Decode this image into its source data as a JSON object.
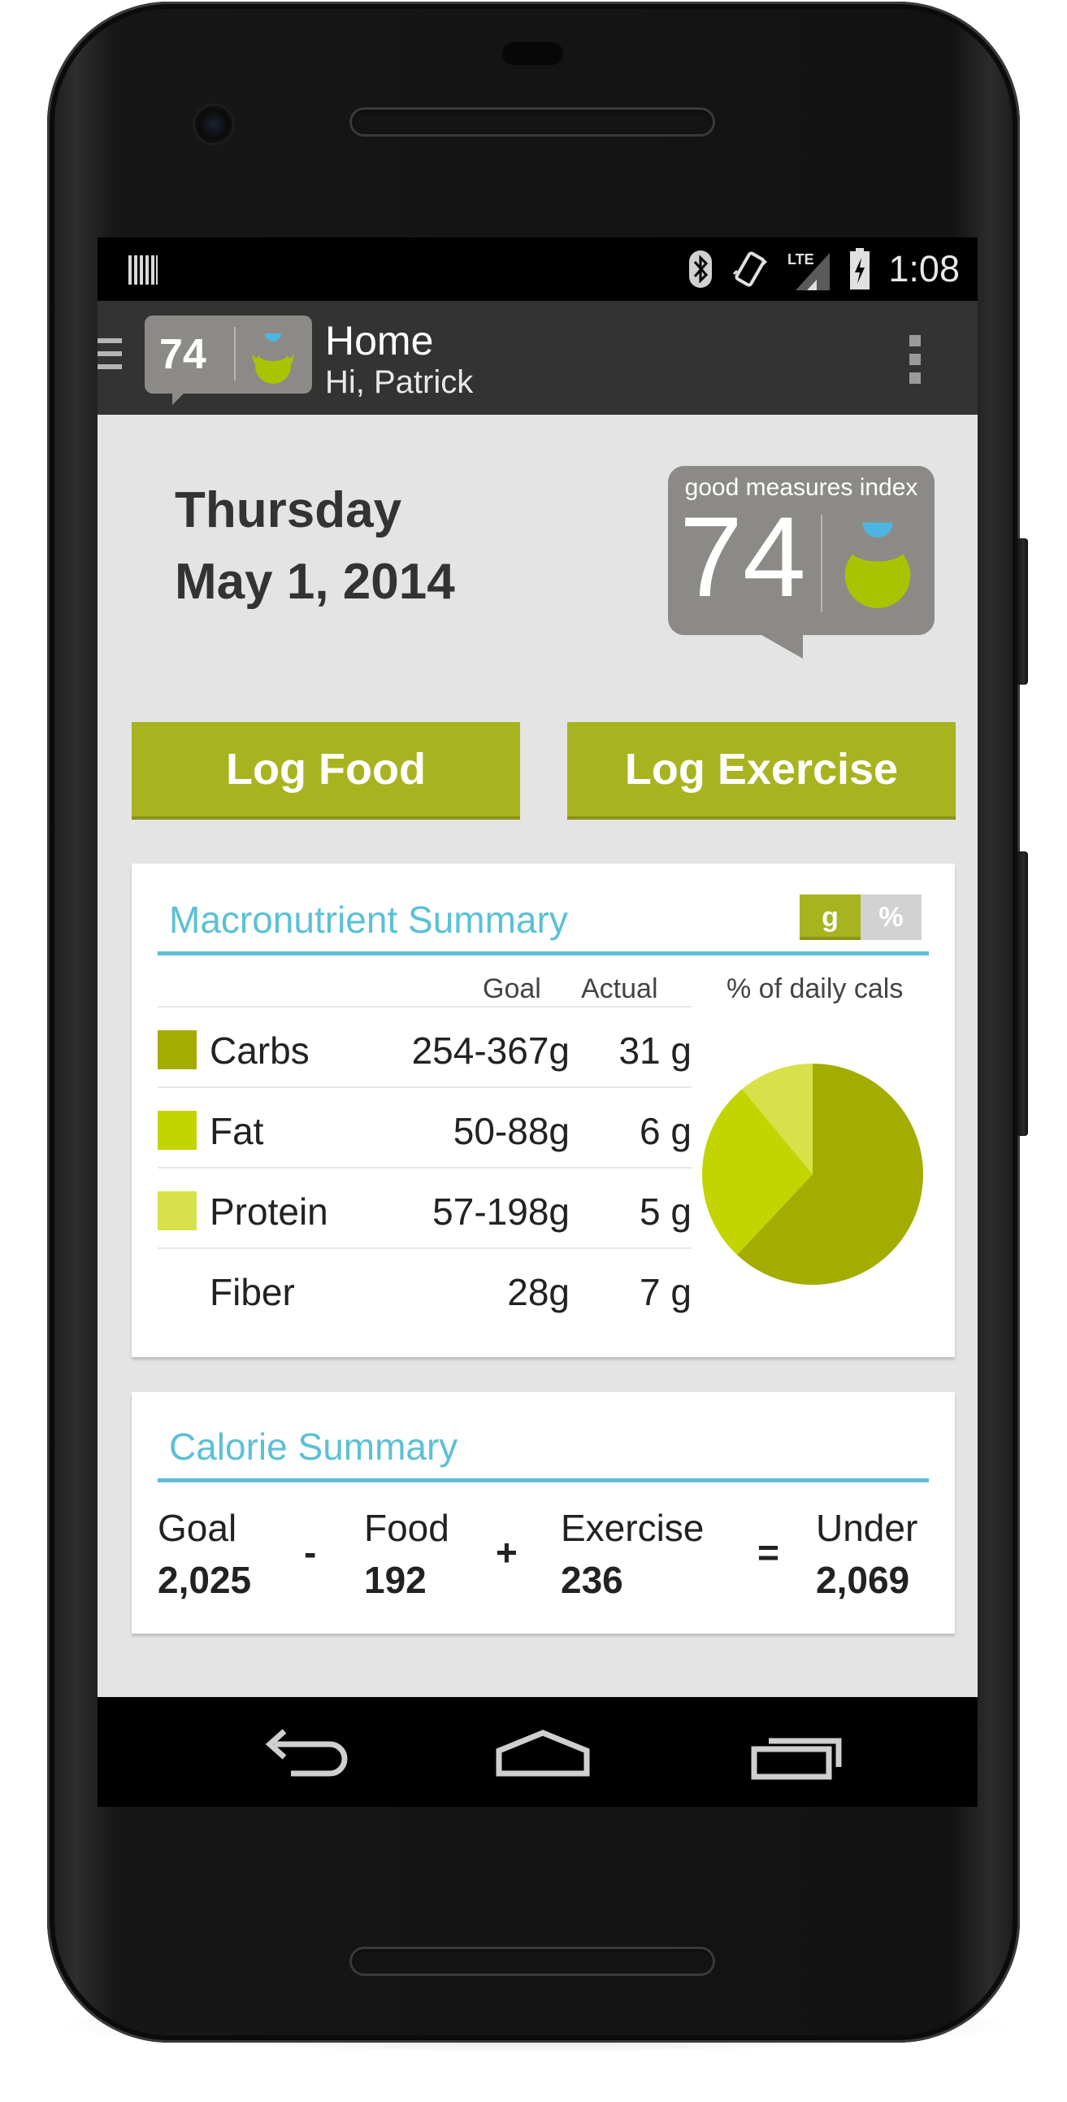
{
  "status_bar": {
    "network": "LTE",
    "time": "1:08",
    "icons": [
      "barcode-icon",
      "bluetooth-icon",
      "vibrate-icon",
      "lte-signal-icon",
      "battery-charging-icon"
    ]
  },
  "action_bar": {
    "index_value": "74",
    "title": "Home",
    "subtitle": "Hi, Patrick"
  },
  "date": {
    "weekday": "Thursday",
    "full_date": "May 1, 2014"
  },
  "index_card": {
    "label": "good measures index",
    "value": "74"
  },
  "buttons": {
    "log_food": "Log Food",
    "log_exercise": "Log Exercise"
  },
  "macro": {
    "title": "Macronutrient Summary",
    "toggle": {
      "grams": "g",
      "percent": "%",
      "selected": "g"
    },
    "headers": {
      "goal": "Goal",
      "actual": "Actual",
      "pct": "% of daily cals"
    },
    "rows": [
      {
        "name": "Carbs",
        "goal": "254-367g",
        "actual": "31 g",
        "color": "#a3ad00"
      },
      {
        "name": "Fat",
        "goal": "50-88g",
        "actual": "6 g",
        "color": "#c2d500"
      },
      {
        "name": "Protein",
        "goal": "57-198g",
        "actual": "5 g",
        "color": "#d7e24a"
      },
      {
        "name": "Fiber",
        "goal": "28g",
        "actual": "7 g",
        "color": ""
      }
    ]
  },
  "chart_data": {
    "type": "pie",
    "title": "% of daily cals",
    "slices": [
      {
        "label": "Carbs",
        "value": 62,
        "color": "#a3ad00"
      },
      {
        "label": "Fat",
        "value": 27,
        "color": "#c2d500"
      },
      {
        "label": "Protein",
        "value": 11,
        "color": "#d7e24a"
      }
    ]
  },
  "calorie": {
    "title": "Calorie Summary",
    "goal_label": "Goal",
    "goal_value": "2,025",
    "minus": "-",
    "food_label": "Food",
    "food_value": "192",
    "plus": "+",
    "exercise_label": "Exercise",
    "exercise_value": "236",
    "equals": "=",
    "result_label": "Under",
    "result_value": "2,069"
  },
  "colors": {
    "accent_green": "#a8b320",
    "accent_blue": "#5bc0d6",
    "index_gray": "#8c8a86"
  }
}
